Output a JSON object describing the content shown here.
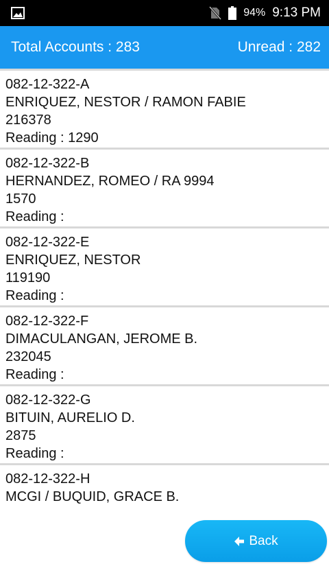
{
  "status": {
    "battery": "94%",
    "time": "9:13 PM"
  },
  "header": {
    "total": "Total Accounts : 283",
    "unread": "Unread : 282"
  },
  "accounts": [
    {
      "account": "082-12-322-A",
      "name": "ENRIQUEZ, NESTOR / RAMON FABIE",
      "meter": "216378",
      "reading": "Reading : 1290"
    },
    {
      "account": "082-12-322-B",
      "name": "HERNANDEZ, ROMEO / RA 9994",
      "meter": "1570",
      "reading": "Reading :"
    },
    {
      "account": "082-12-322-E",
      "name": "ENRIQUEZ, NESTOR",
      "meter": "119190",
      "reading": "Reading :"
    },
    {
      "account": "082-12-322-F",
      "name": "DIMACULANGAN, JEROME B.",
      "meter": "232045",
      "reading": "Reading :"
    },
    {
      "account": "082-12-322-G",
      "name": "BITUIN, AURELIO D.",
      "meter": "2875",
      "reading": "Reading :"
    },
    {
      "account": "082-12-322-H",
      "name": "MCGI / BUQUID, GRACE B."
    }
  ],
  "back_button": {
    "label": "Back",
    "icon": "arrow-left-icon"
  }
}
